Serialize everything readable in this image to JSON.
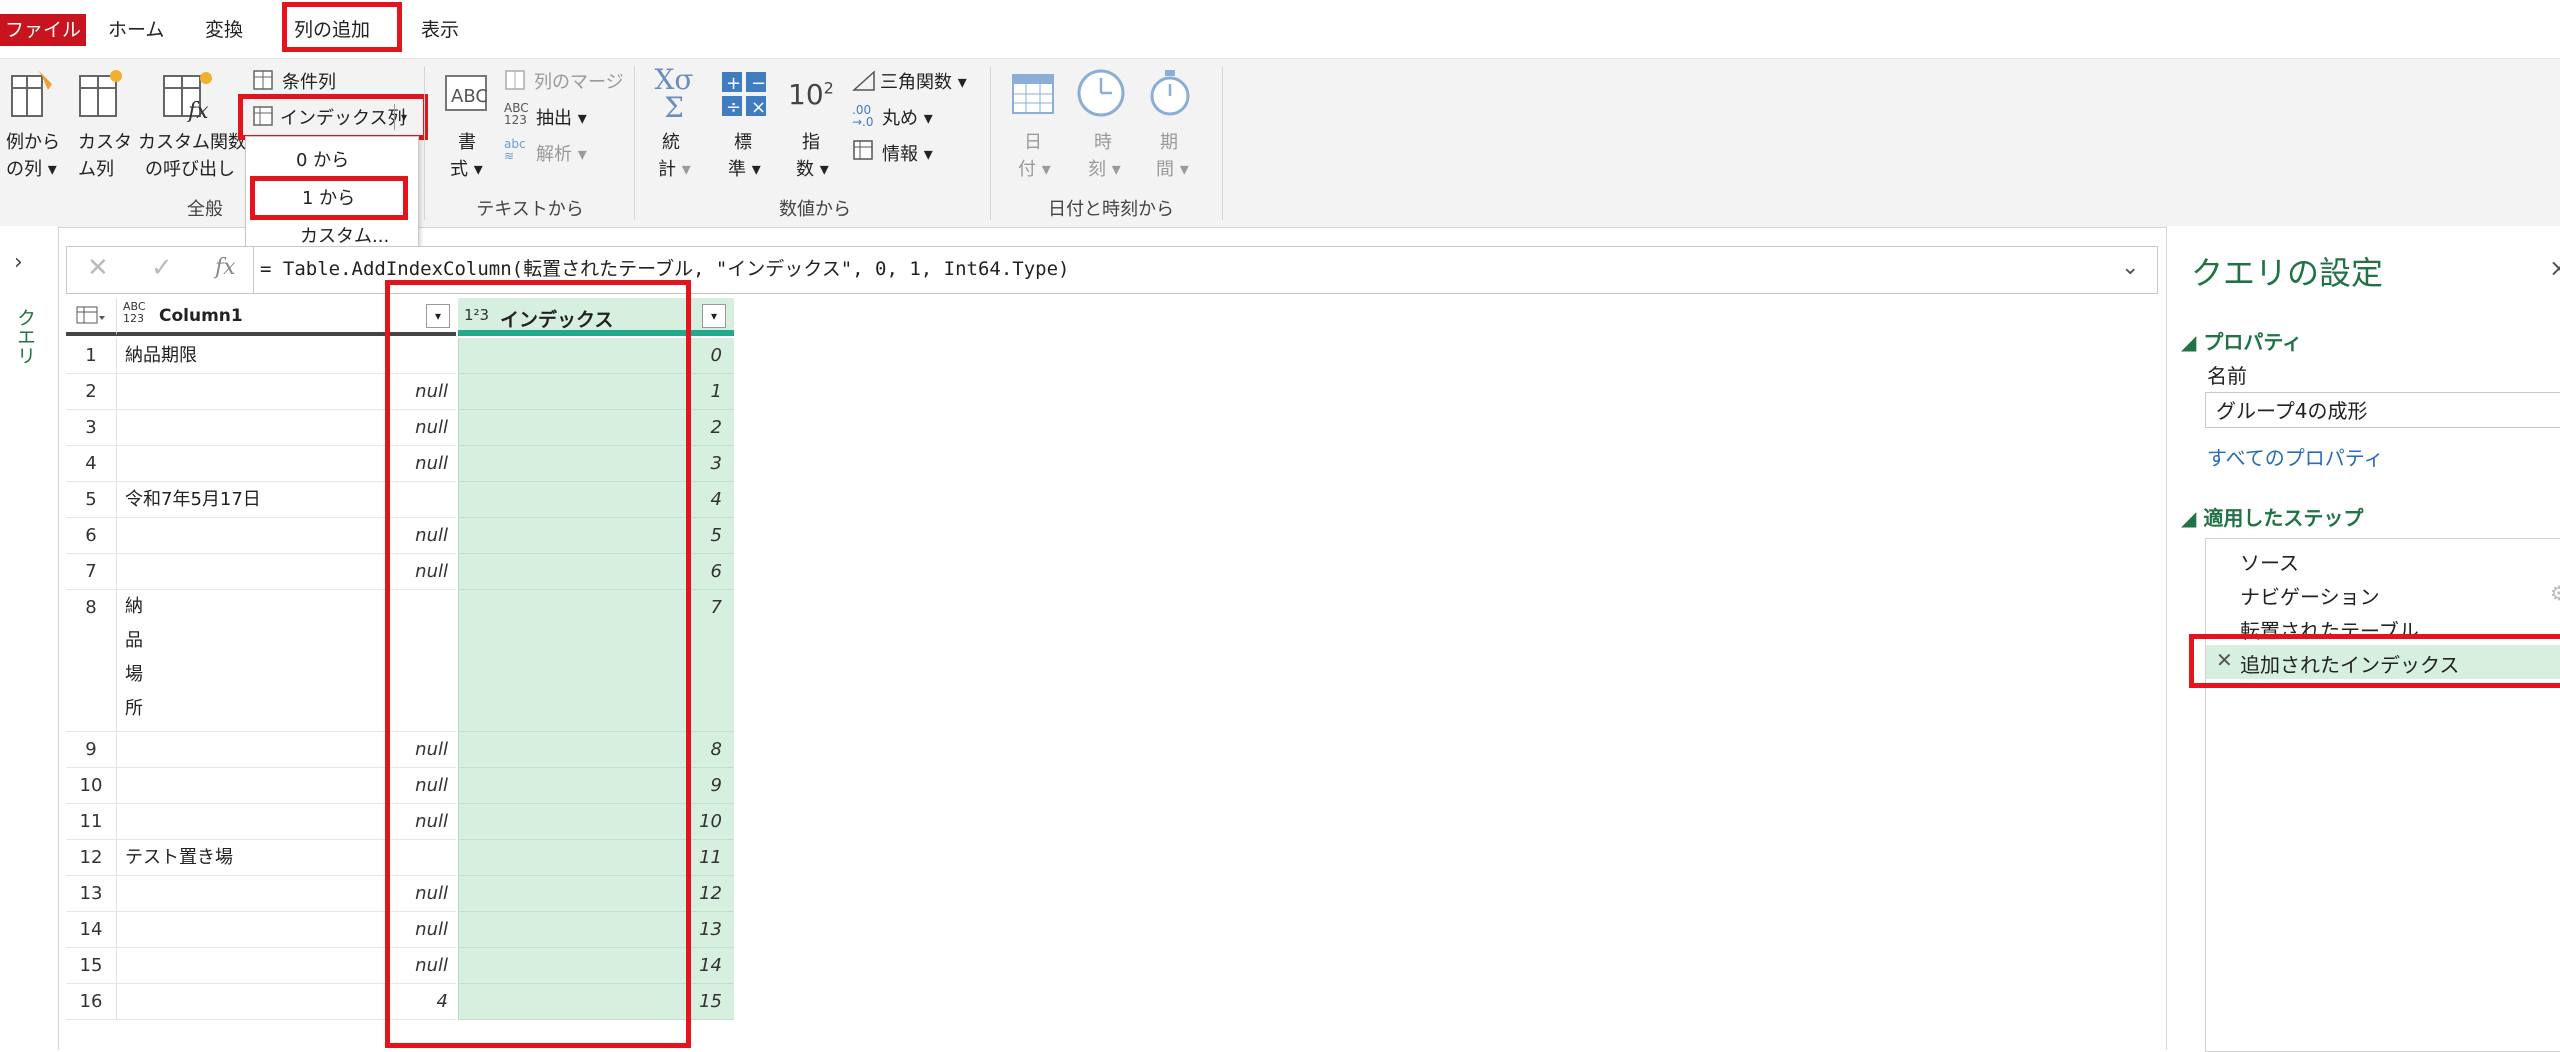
{
  "tabs": {
    "file": "ファイル",
    "home": "ホーム",
    "transform": "変換",
    "add_column": "列の追加",
    "view": "表示"
  },
  "ribbon": {
    "general": {
      "label": "全般",
      "col_from_examples": [
        "例から",
        "の列"
      ],
      "custom_column": [
        "カスタ",
        "ム列"
      ],
      "invoke_custom_function": [
        "カスタム関数",
        "の呼び出し"
      ],
      "conditional_column": "条件列",
      "index_column": "インデックス列"
    },
    "index_dropdown": {
      "items": [
        "0 から",
        "1 から",
        "カスタム..."
      ]
    },
    "text": {
      "label": "テキストから",
      "format": [
        "書",
        "式"
      ],
      "merge_columns": "列のマージ",
      "extract": "抽出",
      "parse": "解析"
    },
    "number": {
      "label": "数値から",
      "statistics": [
        "統",
        "計"
      ],
      "standard": [
        "標",
        "準"
      ],
      "scientific": [
        "指",
        "数"
      ],
      "trigonometry": "三角関数",
      "rounding": "丸め",
      "information": "情報",
      "exponent_sup": "2",
      "exponent_base": "10"
    },
    "datetime": {
      "label": "日付と時刻から",
      "date": [
        "日",
        "付"
      ],
      "time": [
        "時",
        "刻"
      ],
      "duration": [
        "期",
        "間"
      ]
    }
  },
  "queries_pane": {
    "label": "クエリ"
  },
  "formula_bar": {
    "fx": "fx",
    "formula": "= Table.AddIndexColumn(転置されたテーブル, \"インデックス\", 0, 1, Int64.Type)"
  },
  "grid": {
    "col1_type": "ABC\n123",
    "col1_header": "Column1",
    "col2_type": "1²3",
    "col2_header": "インデックス",
    "rows": [
      {
        "n": "1",
        "c1": "納品期限",
        "idx": "0"
      },
      {
        "n": "2",
        "c1": "null",
        "idx": "1"
      },
      {
        "n": "3",
        "c1": "null",
        "idx": "2"
      },
      {
        "n": "4",
        "c1": "null",
        "idx": "3"
      },
      {
        "n": "5",
        "c1": "令和7年5月17日",
        "idx": "4"
      },
      {
        "n": "6",
        "c1": "null",
        "idx": "5"
      },
      {
        "n": "7",
        "c1": "null",
        "idx": "6"
      },
      {
        "n": "8",
        "c1": "納\n品\n場\n所",
        "idx": "7"
      },
      {
        "n": "9",
        "c1": "null",
        "idx": "8"
      },
      {
        "n": "10",
        "c1": "null",
        "idx": "9"
      },
      {
        "n": "11",
        "c1": "null",
        "idx": "10"
      },
      {
        "n": "12",
        "c1": "テスト置き場",
        "idx": "11"
      },
      {
        "n": "13",
        "c1": "null",
        "idx": "12"
      },
      {
        "n": "14",
        "c1": "null",
        "idx": "13"
      },
      {
        "n": "15",
        "c1": "null",
        "idx": "14"
      },
      {
        "n": "16",
        "c1": "4",
        "idx": "15"
      }
    ]
  },
  "settings": {
    "title": "クエリの設定",
    "properties_header": "プロパティ",
    "name_label": "名前",
    "name_value": "グループ4の成形",
    "all_properties": "すべてのプロパティ",
    "steps_header": "適用したステップ",
    "steps": [
      "ソース",
      "ナビゲーション",
      "転置されたテーブル",
      "追加されたインデックス"
    ]
  },
  "colors": {
    "file_tab": "#c8141e",
    "highlight_red": "#e3141b",
    "index_fill": "#d6efdf",
    "accent_green": "#217346"
  }
}
